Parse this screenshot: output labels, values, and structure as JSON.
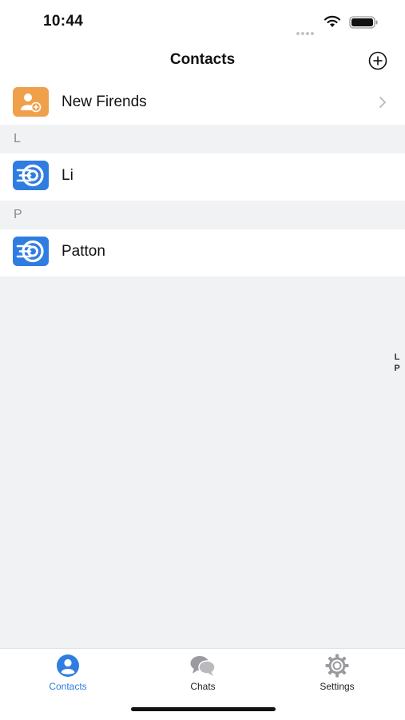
{
  "status_bar": {
    "time": "10:44"
  },
  "nav": {
    "title": "Contacts"
  },
  "new_friends": {
    "label": "New Firends"
  },
  "sections": [
    {
      "letter": "L",
      "contact": "Li"
    },
    {
      "letter": "P",
      "contact": "Patton"
    }
  ],
  "index": [
    "L",
    "P"
  ],
  "tabs": [
    {
      "label": "Contacts",
      "icon": "person-icon",
      "active": true
    },
    {
      "label": "Chats",
      "icon": "chat-bubbles-icon",
      "active": false
    },
    {
      "label": "Settings",
      "icon": "gear-icon",
      "active": false
    }
  ],
  "colors": {
    "accent": "#2f7de1",
    "new_friends_tile": "#f0a04b",
    "contact_tile": "#2f7de1",
    "background": "#f1f2f4"
  }
}
